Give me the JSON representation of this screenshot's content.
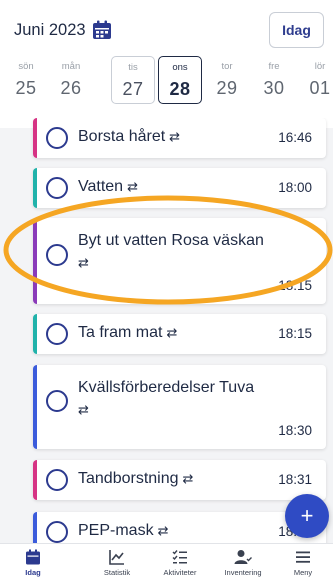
{
  "header": {
    "month": "Juni 2023",
    "month_icon": "calendar-icon",
    "today_button": "Idag",
    "days": [
      {
        "name": "sön",
        "num": "25"
      },
      {
        "name": "mån",
        "num": "26"
      },
      {
        "name": "tis",
        "num": "27"
      },
      {
        "name": "ons",
        "num": "28"
      },
      {
        "name": "tor",
        "num": "29"
      },
      {
        "name": "fre",
        "num": "30"
      },
      {
        "name": "lör",
        "num": "01"
      }
    ],
    "selected_day": "ons"
  },
  "tasks": [
    {
      "title": "Borsta håret",
      "time": "16:46",
      "color": "#d63384"
    },
    {
      "title": "Vatten",
      "time": "18:00",
      "color": "#20b2aa"
    },
    {
      "title": "Byt ut vatten Rosa väskan",
      "time": "18:15",
      "color": "#8a3ab9"
    },
    {
      "title": "Ta fram mat",
      "time": "18:15",
      "color": "#20b2aa"
    },
    {
      "title": "Kvällsförberedelser Tuva",
      "time": "18:30",
      "color": "#3b5bdb"
    },
    {
      "title": "Tandborstning",
      "time": "18:31",
      "color": "#d63384"
    },
    {
      "title": "PEP-mask",
      "time": "18:45",
      "color": "#3b5bdb"
    }
  ],
  "repeat_icon": "repeat-icon",
  "accent_color": "#2c3a8f",
  "highlight_color": "#f5a623",
  "fab": {
    "label": "+"
  },
  "nav": {
    "items": [
      {
        "label": "Idag",
        "icon": "calendar-icon"
      },
      {
        "label": "Statistik",
        "icon": "chart-icon"
      },
      {
        "label": "Aktiviteter",
        "icon": "checklist-icon"
      },
      {
        "label": "Inventering",
        "icon": "person-check-icon"
      },
      {
        "label": "Meny",
        "icon": "menu-icon"
      }
    ],
    "active": "Idag"
  }
}
